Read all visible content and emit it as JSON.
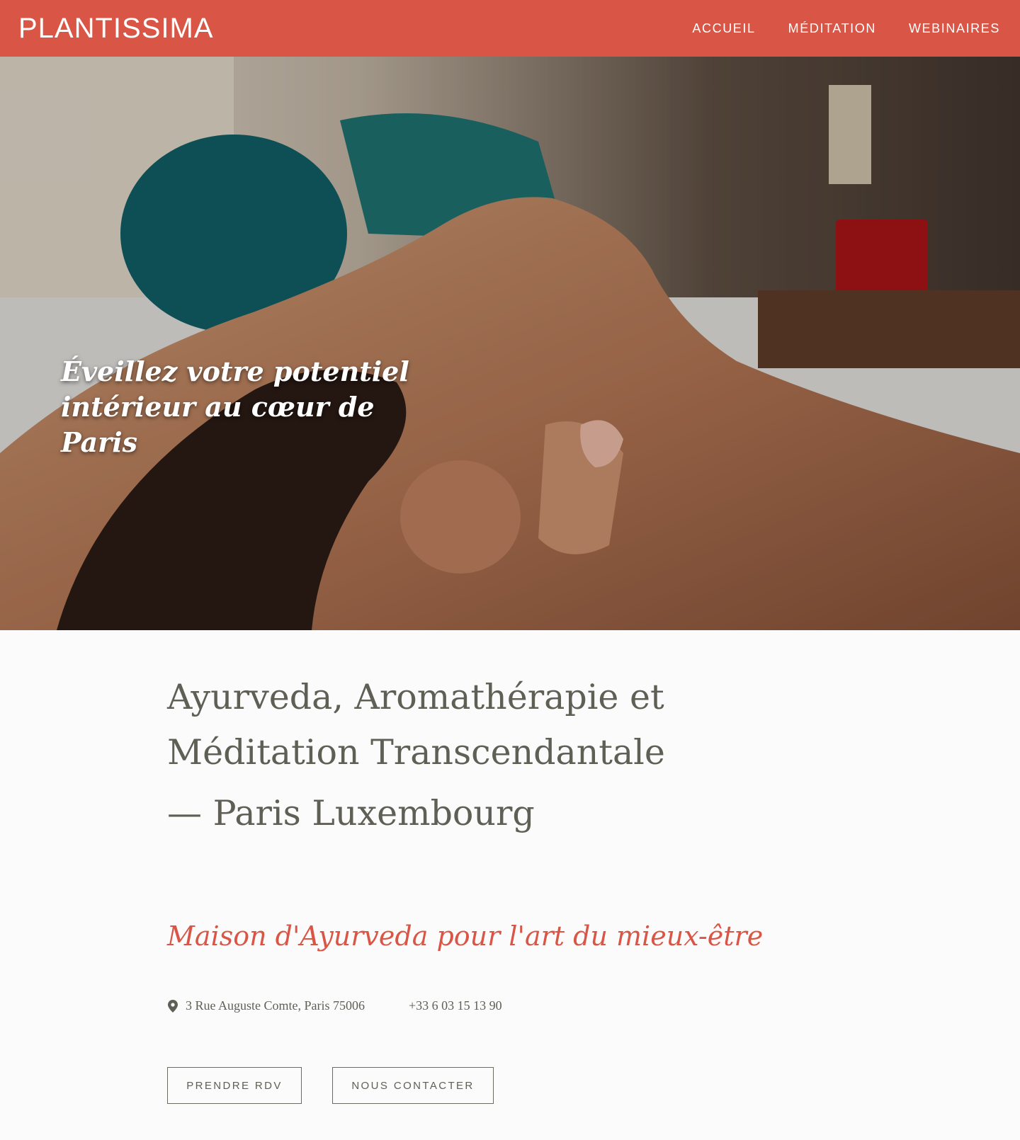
{
  "header": {
    "logo_text": "PLANTISSIMA",
    "nav": [
      {
        "label": "ACCUEIL"
      },
      {
        "label": "MÉDITATION"
      },
      {
        "label": "WEBINAIRES"
      }
    ]
  },
  "hero": {
    "title": "Éveillez votre potentiel intérieur au cœur de Paris"
  },
  "main": {
    "heading": "Ayurveda, Aromathérapie et Méditation Transcendantale",
    "subheading": "— Paris Luxembourg",
    "tagline": "Maison d'Ayurveda pour l'art du mieux-être",
    "address": "3 Rue Auguste Comte, Paris 75006",
    "phone": "+33 6 03 15 13 90",
    "buttons": {
      "rdv": "PRENDRE RDV",
      "contact": "NOUS CONTACTER"
    }
  },
  "colors": {
    "brand": "#d95545",
    "text": "#5f5f56",
    "background": "#fbfbfb"
  },
  "icons": {
    "location": "location-pin-icon"
  }
}
